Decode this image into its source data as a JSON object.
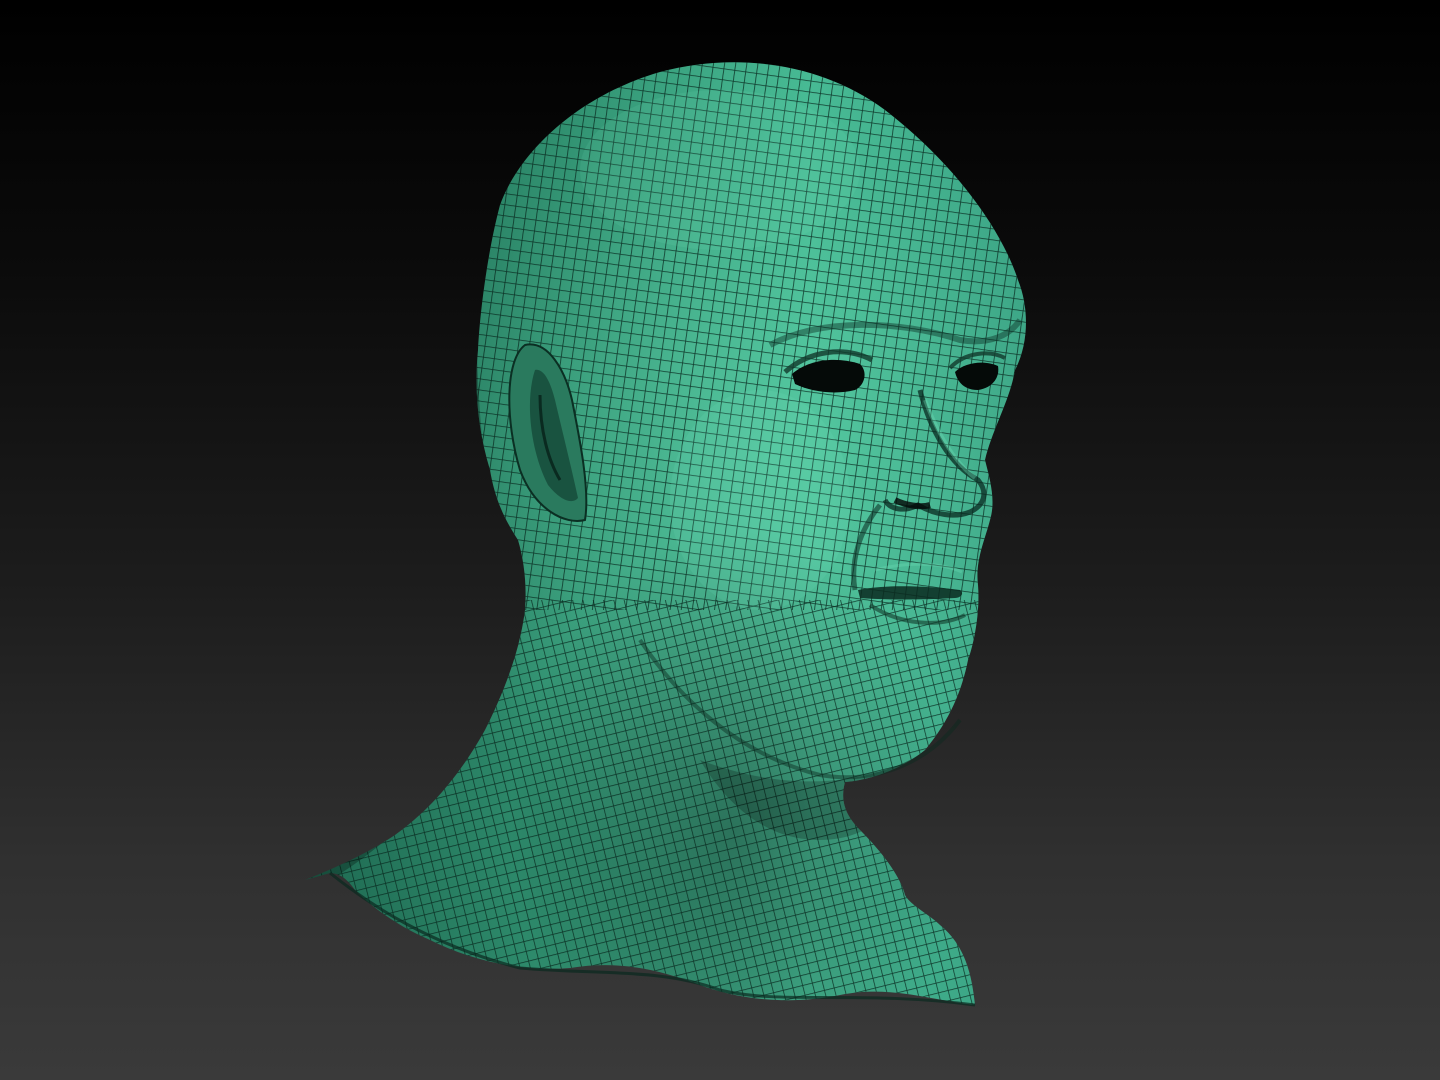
{
  "viewport": {
    "background_top": "#000000",
    "background_bottom": "#3a3a3a"
  },
  "model": {
    "subject": "head-bust-mesh",
    "shading": "wireframe-on-shaded",
    "surface_color": "#3fae8a",
    "wire_color": "#0a2a20"
  }
}
